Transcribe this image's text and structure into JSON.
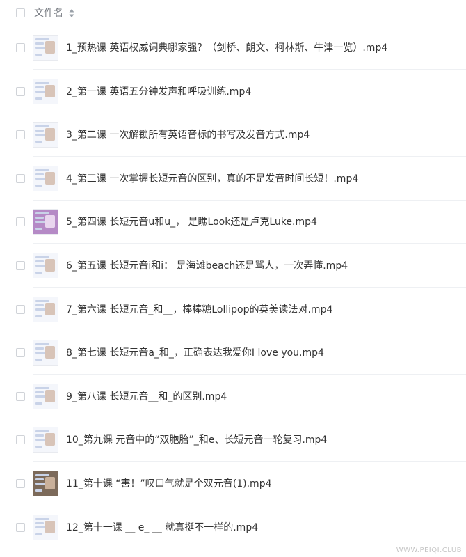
{
  "header": {
    "column_label": "文件名"
  },
  "files": [
    {
      "name": "1_预热课 英语权威词典哪家强？（剑桥、朗文、柯林斯、牛津一览）.mp4",
      "thumb": "light"
    },
    {
      "name": "2_第一课 英语五分钟发声和呼吸训练.mp4",
      "thumb": "light"
    },
    {
      "name": "3_第二课 一次解锁所有英语音标的书写及发音方式.mp4",
      "thumb": "light"
    },
    {
      "name": "4_第三课 一次掌握长短元音的区别，真的不是发音时间长短！.mp4",
      "thumb": "light"
    },
    {
      "name": "5_第四课 长短元音u和u_， 是瞧Look还是卢克Luke.mp4",
      "thumb": "purple"
    },
    {
      "name": "6_第五课 长短元音i和i： 是海滩beach还是骂人，一次弄懂.mp4",
      "thumb": "light"
    },
    {
      "name": "7_第六课 长短元音_和__，棒棒糖Lollipop的英美读法对.mp4",
      "thumb": "light"
    },
    {
      "name": "8_第七课 长短元音a_和_，正确表达我爱你I love you.mp4",
      "thumb": "light"
    },
    {
      "name": "9_第八课 长短元音__和_的区别.mp4",
      "thumb": "light"
    },
    {
      "name": "10_第九课 元音中的“双胞胎”_和e、长短元音一轮复习.mp4",
      "thumb": "light"
    },
    {
      "name": "11_第十课 “害！”叹口气就是个双元音(1).mp4",
      "thumb": "dark"
    },
    {
      "name": "12_第十一课 __ e_ __ 就真挺不一样的.mp4",
      "thumb": "light"
    }
  ],
  "watermark": "WWW.PEIQI.CLUB",
  "icons": {
    "sort": "sort-icon",
    "checkbox": "checkbox-icon",
    "thumbnail": "video-thumbnail"
  },
  "colors": {
    "text": "#333333",
    "header_text": "#777b82",
    "divider": "#eef0f3",
    "checkbox_border": "#d0d3d8"
  }
}
